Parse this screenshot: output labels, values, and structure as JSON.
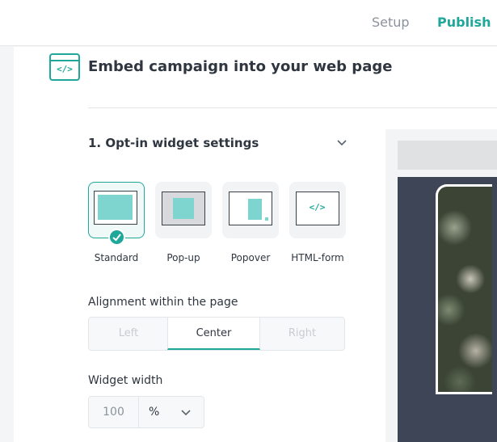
{
  "header": {
    "tabs": [
      {
        "label": "Setup",
        "active": false
      },
      {
        "label": "Publish",
        "active": true
      }
    ]
  },
  "panel": {
    "title": "Embed campaign into your web page",
    "icon": "code-embed-icon"
  },
  "widget_settings": {
    "section_title": "1. Opt-in widget settings",
    "types": [
      {
        "label": "Standard",
        "selected": true,
        "icon": "standard-layout-icon"
      },
      {
        "label": "Pop-up",
        "selected": false,
        "icon": "popup-layout-icon"
      },
      {
        "label": "Popover",
        "selected": false,
        "icon": "popover-layout-icon"
      },
      {
        "label": "HTML-form",
        "selected": false,
        "icon": "html-form-icon"
      }
    ],
    "alignment": {
      "label": "Alignment within the page",
      "options": [
        "Left",
        "Center",
        "Right"
      ],
      "selected": "Center"
    },
    "width": {
      "label": "Widget width",
      "value": "100",
      "unit": "%"
    }
  },
  "colors": {
    "accent": "#1fa79a",
    "text": "#2f3640",
    "muted": "#8a939c",
    "preview_bg": "#3e4556"
  }
}
